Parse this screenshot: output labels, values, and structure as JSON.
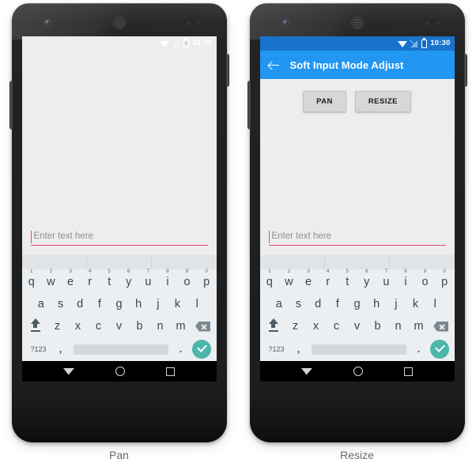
{
  "panels": [
    {
      "caption": "Pan",
      "status_bar": {
        "style": "light",
        "clock": "10:30",
        "icons": [
          "wifi-icon",
          "signal-off-icon",
          "battery-icon"
        ]
      },
      "app_bar_visible": false,
      "app_bar": {
        "title": "Soft Input Mode Adjust",
        "back_icon": "back-arrow-icon"
      },
      "buttons_visible": false,
      "buttons": [
        {
          "label": "PAN"
        },
        {
          "label": "RESIZE"
        }
      ],
      "text_field": {
        "placeholder": "Enter text here",
        "value": "",
        "underline_color": "#e9437f"
      }
    },
    {
      "caption": "Resize",
      "status_bar": {
        "style": "blue",
        "clock": "10:30",
        "icons": [
          "wifi-icon",
          "signal-off-icon",
          "battery-icon"
        ]
      },
      "app_bar_visible": true,
      "app_bar": {
        "title": "Soft Input Mode Adjust",
        "back_icon": "back-arrow-icon"
      },
      "buttons_visible": true,
      "buttons": [
        {
          "label": "PAN"
        },
        {
          "label": "RESIZE"
        }
      ],
      "text_field": {
        "placeholder": "Enter text here",
        "value": "",
        "underline_color": "#e9437f"
      }
    }
  ],
  "keyboard": {
    "suggestion_cells": 3,
    "row1": [
      {
        "key": "q",
        "num": "1"
      },
      {
        "key": "w",
        "num": "2"
      },
      {
        "key": "e",
        "num": "3"
      },
      {
        "key": "r",
        "num": "4"
      },
      {
        "key": "t",
        "num": "5"
      },
      {
        "key": "y",
        "num": "6"
      },
      {
        "key": "u",
        "num": "7"
      },
      {
        "key": "i",
        "num": "8"
      },
      {
        "key": "o",
        "num": "9"
      },
      {
        "key": "p",
        "num": "0"
      }
    ],
    "row2": [
      "a",
      "s",
      "d",
      "f",
      "g",
      "h",
      "j",
      "k",
      "l"
    ],
    "row3": [
      "z",
      "x",
      "c",
      "v",
      "b",
      "n",
      "m"
    ],
    "shift_icon": "shift-icon",
    "backspace_icon": "backspace-icon",
    "symbols_label": "?123",
    "comma_label": ",",
    "period_label": ".",
    "enter_icon": "checkmark-icon",
    "space_label": ""
  },
  "nav_bar": {
    "back_icon": "nav-back-triangle-icon",
    "home_icon": "nav-home-circle-icon",
    "recents_icon": "nav-recents-square-icon"
  },
  "colors": {
    "app_bar": "#2196f3",
    "status_bar_blue": "#1873cc",
    "screen_bg": "#eceded",
    "keyboard_bg": "#eceff1",
    "suggestion_bg": "#e0e4e6",
    "field_underline": "#e9437f",
    "enter_key": "#4db6ac",
    "nav_bar": "#000000",
    "caption_text": "#6b6b6b"
  }
}
